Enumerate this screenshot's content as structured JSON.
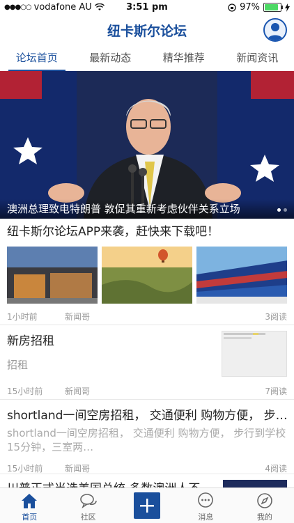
{
  "status_bar": {
    "carrier": "vodafone AU",
    "time": "3:51 pm",
    "battery": "97%",
    "battery_level": 0.97
  },
  "header": {
    "title": "纽卡斯尔论坛"
  },
  "tabs": [
    {
      "label": "论坛首页",
      "active": true
    },
    {
      "label": "最新动态",
      "active": false
    },
    {
      "label": "精华推荐",
      "active": false
    },
    {
      "label": "新闻资讯",
      "active": false
    }
  ],
  "banner": {
    "caption": "澳洲总理致电特朗普 敦促其重新考虑伙伴关系立场",
    "page_count": 2,
    "current_page": 1
  },
  "posts": [
    {
      "title": "纽卡斯尔论坛APP来袭，赶快来下载吧！",
      "time": "1小时前",
      "author": "新闻哥",
      "reads": "3阅读"
    },
    {
      "title": "新房招租",
      "snippet": "招租",
      "time": "15小时前",
      "author": "新闻哥",
      "reads": "7阅读"
    },
    {
      "title": "shortland一间空房招租， 交通便利 购物方便， 步…",
      "snippet": "shortland一间空房招租， 交通便利 购物方便， 步行到学校15分钟，三室两…",
      "time": "15小时前",
      "author": "新闻哥",
      "reads": "4阅读"
    },
    {
      "title": "川普正式当选美国总统 多数澳洲人不…"
    }
  ],
  "tabbar": [
    {
      "label": "首页",
      "icon": "home-icon",
      "active": true
    },
    {
      "label": "社区",
      "icon": "chat-bubbles-icon",
      "active": false
    },
    {
      "label": "",
      "icon": "plus-icon",
      "active": false
    },
    {
      "label": "消息",
      "icon": "message-icon",
      "active": false
    },
    {
      "label": "我的",
      "icon": "compass-icon",
      "active": false
    }
  ],
  "colors": {
    "brand": "#1a4f9c",
    "battery": "#4cd964",
    "muted_text": "#999999"
  }
}
